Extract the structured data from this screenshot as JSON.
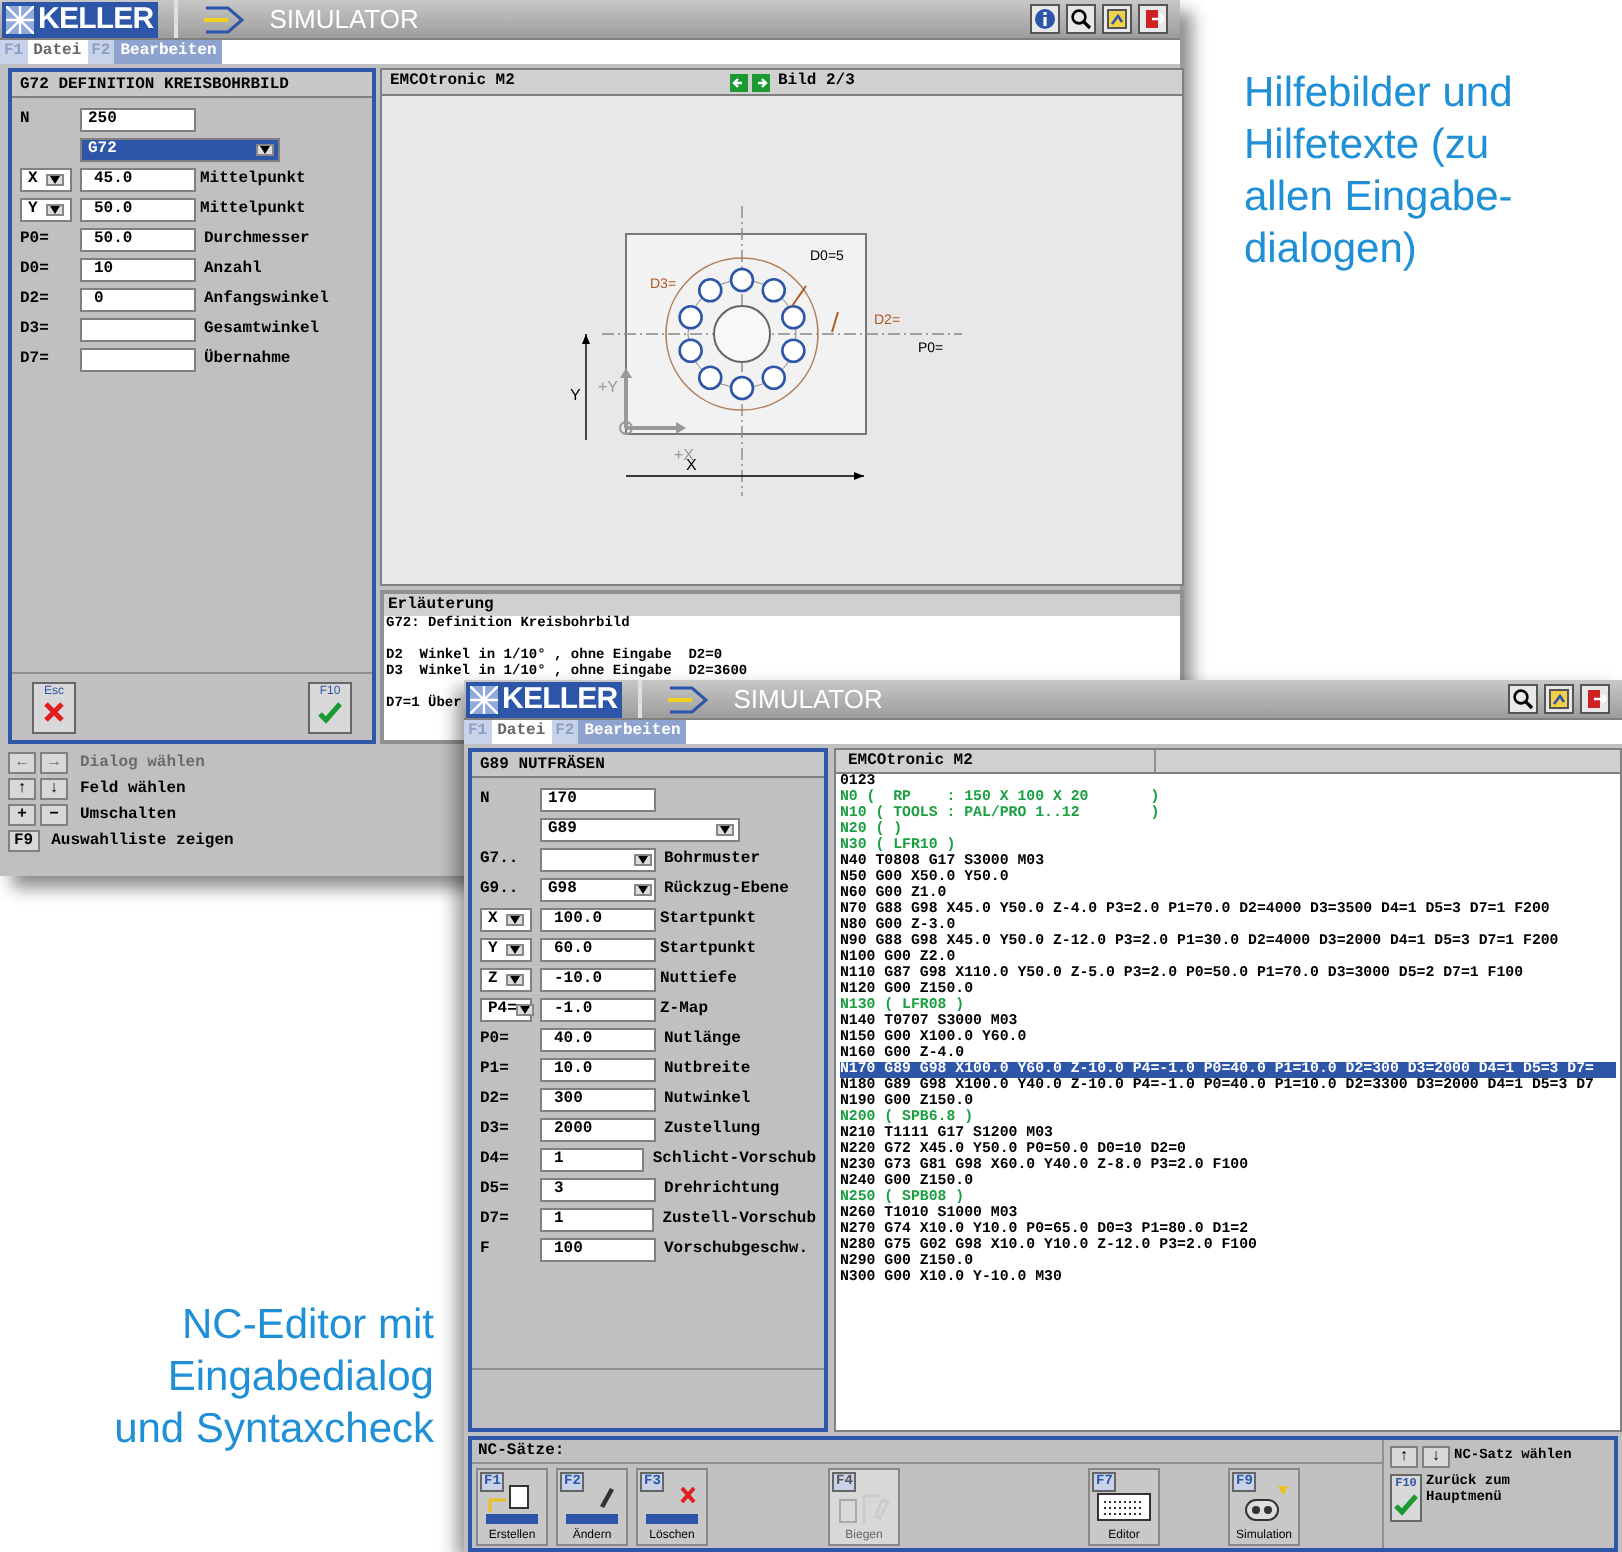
{
  "help_window": {
    "logo": "KELLER",
    "app_title": "SIMULATOR",
    "toolbar": [
      {
        "kind": "info"
      },
      {
        "kind": "search"
      },
      {
        "kind": "help"
      },
      {
        "kind": "exit"
      }
    ],
    "menu": [
      {
        "key": "F1",
        "label": "Datei",
        "selected": false
      },
      {
        "key": "F2",
        "label": "Bearbeiten",
        "selected": true
      }
    ],
    "dialog": {
      "title": "G72 DEFINITION KREISBOHRBILD",
      "fields": [
        {
          "kind": "readonly",
          "label": "N",
          "value": "250"
        },
        {
          "kind": "select",
          "value": "G72",
          "focused": true
        },
        {
          "kind": "axis",
          "axis": "X",
          "value": "45.0",
          "description": "Mittelpunkt"
        },
        {
          "kind": "axis",
          "axis": "Y",
          "value": "50.0",
          "description": "Mittelpunkt"
        },
        {
          "kind": "input",
          "label": "P0=",
          "value": "50.0",
          "description": "Durchmesser"
        },
        {
          "kind": "input",
          "label": "D0=",
          "value": "10",
          "description": "Anzahl"
        },
        {
          "kind": "input",
          "label": "D2=",
          "value": "0",
          "description": "Anfangswinkel"
        },
        {
          "kind": "input",
          "label": "D3=",
          "description": "Gesamtwinkel"
        },
        {
          "kind": "input",
          "label": "D7=",
          "description": "Übernahme"
        }
      ],
      "buttons": [
        {
          "key": "Esc",
          "kind": "cancel"
        },
        {
          "key": "F10",
          "kind": "confirm"
        }
      ]
    },
    "viewer": {
      "title": "EMCOtronic M2",
      "page": "Bild 2/3",
      "drawing_labels": [
        "D0=5",
        "D3=",
        "D2=",
        "P0=",
        "Y",
        "+Y",
        "+X",
        "X"
      ]
    },
    "explanation": {
      "title": "Erläuterung",
      "paragraphs": [
        [
          "G72: Definition Kreisbohrbild"
        ],
        [
          "D2  Winkel in 1/10° , ohne Eingabe  D2=0",
          "D3  Winkel in 1/10° , ohne Eingabe  D2=3600"
        ],
        [
          "D7=1 Über"
        ]
      ]
    },
    "key_help": [
      {
        "keys": [
          "←",
          "→"
        ],
        "label": "Dialog wählen",
        "disabled": true
      },
      {
        "keys": [
          "↑",
          "↓"
        ],
        "label": "Feld wählen",
        "disabled": false
      },
      {
        "keys": [
          "+",
          "−"
        ],
        "label": "Umschalten",
        "disabled": false
      },
      {
        "keys": [
          "F9"
        ],
        "label": "Auswahlliste zeigen",
        "disabled": false
      }
    ]
  },
  "editor_window": {
    "logo": "KELLER",
    "app_title": "SIMULATOR",
    "toolbar": [
      {
        "kind": "search"
      },
      {
        "kind": "help"
      },
      {
        "kind": "exit"
      }
    ],
    "menu": [
      {
        "key": "F1",
        "label": "Datei",
        "selected": false
      },
      {
        "key": "F2",
        "label": "Bearbeiten",
        "selected": true
      }
    ],
    "dialog": {
      "title": "G89 NUTFRÄSEN",
      "fields": [
        {
          "kind": "readonly",
          "label": "N",
          "value": "170"
        },
        {
          "kind": "select",
          "value": "G89",
          "focused": false
        },
        {
          "kind": "option",
          "label": "G7..",
          "description": "Bohrmuster"
        },
        {
          "kind": "option",
          "label": "G9..",
          "value": "G98",
          "description": "Rückzug-Ebene"
        },
        {
          "kind": "axis",
          "axis": "X",
          "value": "100.0",
          "description": "Startpunkt"
        },
        {
          "kind": "axis",
          "axis": "Y",
          "value": "60.0",
          "description": "Startpunkt"
        },
        {
          "kind": "axis",
          "axis": "Z",
          "value": "-10.0",
          "description": "Nuttiefe"
        },
        {
          "kind": "axis",
          "axis": "P4=",
          "value": "-1.0",
          "description": "Z-Map"
        },
        {
          "kind": "input",
          "label": "P0=",
          "value": "40.0",
          "description": "Nutlänge"
        },
        {
          "kind": "input",
          "label": "P1=",
          "value": "10.0",
          "description": "Nutbreite"
        },
        {
          "kind": "input",
          "label": "D2=",
          "value": "300",
          "description": "Nutwinkel"
        },
        {
          "kind": "input",
          "label": "D3=",
          "value": "2000",
          "description": "Zustellung"
        },
        {
          "kind": "input",
          "label": "D4=",
          "value": "1",
          "description": "Schlicht-Vorschub"
        },
        {
          "kind": "input",
          "label": "D5=",
          "value": "3",
          "description": "Drehrichtung"
        },
        {
          "kind": "input",
          "label": "D7=",
          "value": "1",
          "description": "Zustell-Vorschub"
        },
        {
          "kind": "input",
          "label": "F",
          "value": "100",
          "description": "Vorschubgeschw."
        }
      ]
    },
    "program": {
      "title": "EMCOtronic M2",
      "lines": [
        {
          "kind": "block",
          "text": "0123",
          "selected": false
        },
        {
          "kind": "comment",
          "text": "N0 (  RP    : 150 X 100 X 20       )",
          "selected": false
        },
        {
          "kind": "comment",
          "text": "N10 ( TOOLS : PAL/PRO 1..12        )",
          "selected": false
        },
        {
          "kind": "comment",
          "text": "N20 ( )",
          "selected": false
        },
        {
          "kind": "comment",
          "text": "N30 ( LFR10 )",
          "selected": false
        },
        {
          "kind": "block",
          "text": "N40 T0808 G17 S3000 M03",
          "selected": false
        },
        {
          "kind": "block",
          "text": "N50 G00 X50.0 Y50.0",
          "selected": false
        },
        {
          "kind": "block",
          "text": "N60 G00 Z1.0",
          "selected": false
        },
        {
          "kind": "block",
          "text": "N70 G88 G98 X45.0 Y50.0 Z-4.0 P3=2.0 P1=70.0 D2=4000 D3=3500 D4=1 D5=3 D7=1 F200",
          "selected": false
        },
        {
          "kind": "block",
          "text": "N80 G00 Z-3.0",
          "selected": false
        },
        {
          "kind": "block",
          "text": "N90 G88 G98 X45.0 Y50.0 Z-12.0 P3=2.0 P1=30.0 D2=4000 D3=2000 D4=1 D5=3 D7=1 F200",
          "selected": false
        },
        {
          "kind": "block",
          "text": "N100 G00 Z2.0",
          "selected": false
        },
        {
          "kind": "block",
          "text": "N110 G87 G98 X110.0 Y50.0 Z-5.0 P3=2.0 P0=50.0 P1=70.0 D3=3000 D5=2 D7=1 F100",
          "selected": false
        },
        {
          "kind": "block",
          "text": "N120 G00 Z150.0",
          "selected": false
        },
        {
          "kind": "comment",
          "text": "N130 ( LFR08 )",
          "selected": false
        },
        {
          "kind": "block",
          "text": "N140 T0707 S3000 M03",
          "selected": false
        },
        {
          "kind": "block",
          "text": "N150 G00 X100.0 Y60.0",
          "selected": false
        },
        {
          "kind": "block",
          "text": "N160 G00 Z-4.0",
          "selected": false
        },
        {
          "kind": "block",
          "text": "N170 G89 G98 X100.0 Y60.0 Z-10.0 P4=-1.0 P0=40.0 P1=10.0 D2=300 D3=2000 D4=1 D5=3 D7=",
          "selected": true
        },
        {
          "kind": "block",
          "text": "N180 G89 G98 X100.0 Y40.0 Z-10.0 P4=-1.0 P0=40.0 P1=10.0 D2=3300 D3=2000 D4=1 D5=3 D7",
          "selected": false
        },
        {
          "kind": "block",
          "text": "N190 G00 Z150.0",
          "selected": false
        },
        {
          "kind": "comment",
          "text": "N200 ( SPB6.8 )",
          "selected": false
        },
        {
          "kind": "block",
          "text": "N210 T1111 G17 S1200 M03",
          "selected": false
        },
        {
          "kind": "block",
          "text": "N220 G72 X45.0 Y50.0 P0=50.0 D0=10 D2=0",
          "selected": false
        },
        {
          "kind": "block",
          "text": "N230 G73 G81 G98 X60.0 Y40.0 Z-8.0 P3=2.0 F100",
          "selected": false
        },
        {
          "kind": "block",
          "text": "N240 G00 Z150.0",
          "selected": false
        },
        {
          "kind": "comment",
          "text": "N250 ( SPB08 )",
          "selected": false
        },
        {
          "kind": "block",
          "text": "N260 T1010 S1000 M03",
          "selected": false
        },
        {
          "kind": "block",
          "text": "N270 G74 X10.0 Y10.0 P0=65.0 D0=3 P1=80.0 D1=2",
          "selected": false
        },
        {
          "kind": "block",
          "text": "N280 G75 G02 G98 X10.0 Y10.0 Z-12.0 P3=2.0 F100",
          "selected": false
        },
        {
          "kind": "block",
          "text": "N290 G00 Z150.0",
          "selected": false
        },
        {
          "kind": "block",
          "text": "N300 G00 X10.0 Y-10.0 M30",
          "selected": false
        }
      ]
    },
    "function_bar": {
      "title": "NC-Sätze:",
      "buttons": [
        {
          "key": "F1",
          "kind": "create",
          "label": "Erstellen",
          "disabled": false
        },
        {
          "key": "F2",
          "kind": "edit",
          "label": "Ändern",
          "disabled": false
        },
        {
          "key": "F3",
          "kind": "delete",
          "label": "Löschen",
          "disabled": false
        },
        {
          "key": "F4",
          "kind": "bend",
          "label": "Biegen",
          "disabled": true
        },
        {
          "key": "F7",
          "kind": "editor",
          "label": "Editor",
          "disabled": false
        },
        {
          "key": "F9",
          "kind": "simulation",
          "label": "Simulation",
          "disabled": false
        }
      ],
      "select_keys": [
        "↑",
        "↓"
      ],
      "select_label": "NC-Satz wählen",
      "back_key": "F10",
      "back_label": "Zurück zum Hauptmenü"
    }
  },
  "captions": {
    "help": "Hilfebilder und\nHilfetexte (zu\nallen Eingabe-\ndialogen)",
    "editor": "NC-Editor mit\nEingabedialog\nund Syntaxcheck"
  }
}
